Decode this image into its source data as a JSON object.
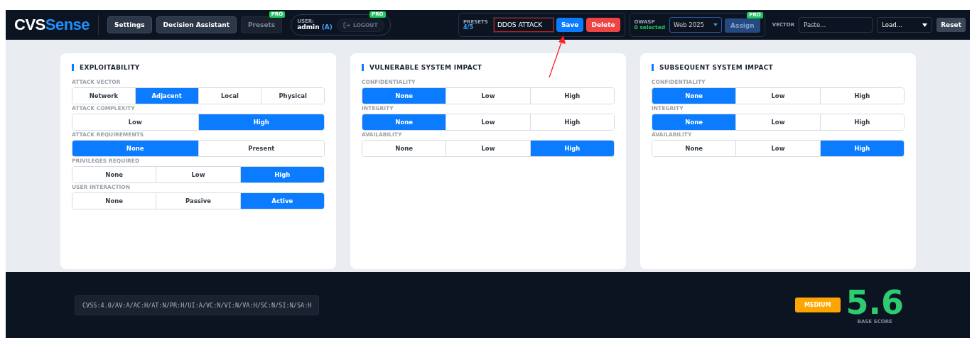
{
  "logo": {
    "part_1": "CVS",
    "part_2": "Sense"
  },
  "nav": [
    {
      "label": "Settings",
      "disabled": false,
      "pro": false
    },
    {
      "label": "Decision Assistant",
      "disabled": false,
      "pro": false
    },
    {
      "label": "Presets",
      "disabled": true,
      "pro": "PRO"
    }
  ],
  "user": {
    "label": "USER:",
    "name": "admin",
    "role": "(A)",
    "logout": "LOGOUT",
    "logout_disabled": true,
    "pro": "PRO"
  },
  "presets": {
    "label": "PRESETS",
    "count": "4/5",
    "name": "DDOS ATTACK",
    "save": "Save",
    "delete": "Delete"
  },
  "owasp": {
    "label": "OWASP",
    "selected_text": "0 selected",
    "list": "Web 2025",
    "assign": "Assign",
    "pro": "PRO"
  },
  "vector": {
    "label": "VECTOR",
    "placeholder": "Paste...",
    "load": "Load...",
    "reset": "Reset"
  },
  "sections": [
    {
      "title": "EXPLOITABILITY",
      "groups": [
        {
          "label": "ATTACK VECTOR",
          "options": [
            {
              "label": "Network",
              "selected": false
            },
            {
              "label": "Adjacent",
              "selected": true
            },
            {
              "label": "Local",
              "selected": false
            },
            {
              "label": "Physical",
              "selected": false
            }
          ]
        },
        {
          "label": "ATTACK COMPLEXITY",
          "options": [
            {
              "label": "Low",
              "selected": false
            },
            {
              "label": "High",
              "selected": true
            }
          ]
        },
        {
          "label": "ATTACK REQUIREMENTS",
          "options": [
            {
              "label": "None",
              "selected": true
            },
            {
              "label": "Present",
              "selected": false
            }
          ]
        },
        {
          "label": "PRIVILEGES REQUIRED",
          "options": [
            {
              "label": "None",
              "selected": false
            },
            {
              "label": "Low",
              "selected": false
            },
            {
              "label": "High",
              "selected": true
            }
          ]
        },
        {
          "label": "USER INTERACTION",
          "options": [
            {
              "label": "None",
              "selected": false
            },
            {
              "label": "Passive",
              "selected": false
            },
            {
              "label": "Active",
              "selected": true
            }
          ]
        }
      ]
    },
    {
      "title": "VULNERABLE SYSTEM IMPACT",
      "groups": [
        {
          "label": "CONFIDENTIALITY",
          "options": [
            {
              "label": "None",
              "selected": true
            },
            {
              "label": "Low",
              "selected": false
            },
            {
              "label": "High",
              "selected": false
            }
          ]
        },
        {
          "label": "INTEGRITY",
          "options": [
            {
              "label": "None",
              "selected": true
            },
            {
              "label": "Low",
              "selected": false
            },
            {
              "label": "High",
              "selected": false
            }
          ]
        },
        {
          "label": "AVAILABILITY",
          "options": [
            {
              "label": "None",
              "selected": false
            },
            {
              "label": "Low",
              "selected": false
            },
            {
              "label": "High",
              "selected": true
            }
          ]
        }
      ]
    },
    {
      "title": "SUBSEQUENT SYSTEM IMPACT",
      "groups": [
        {
          "label": "CONFIDENTIALITY",
          "options": [
            {
              "label": "None",
              "selected": true
            },
            {
              "label": "Low",
              "selected": false
            },
            {
              "label": "High",
              "selected": false
            }
          ]
        },
        {
          "label": "INTEGRITY",
          "options": [
            {
              "label": "None",
              "selected": true
            },
            {
              "label": "Low",
              "selected": false
            },
            {
              "label": "High",
              "selected": false
            }
          ]
        },
        {
          "label": "AVAILABILITY",
          "options": [
            {
              "label": "None",
              "selected": false
            },
            {
              "label": "Low",
              "selected": false
            },
            {
              "label": "High",
              "selected": true
            }
          ]
        }
      ]
    }
  ],
  "footer": {
    "vector_string": "CVSS:4.0/AV:A/AC:H/AT:N/PR:H/UI:A/VC:N/VI:N/VA:H/SC:N/SI:N/SA:H",
    "severity": "MEDIUM",
    "score": "5.6",
    "score_label": "BASE SCORE"
  }
}
